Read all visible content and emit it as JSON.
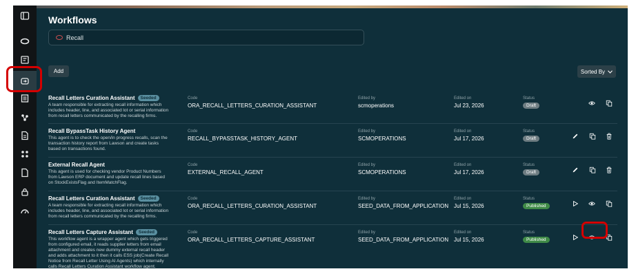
{
  "page": {
    "title": "Workflows"
  },
  "search": {
    "value": "Recall"
  },
  "toolbar": {
    "add_label": "Add",
    "sort_label": "Sorted By"
  },
  "labels": {
    "code": "Code",
    "edited_by": "Edited by",
    "edited_on": "Edited on",
    "status": "Status"
  },
  "sidebar": {
    "items": [
      "panel-toggle-icon",
      "oracle-icon",
      "catalog-icon",
      "workflows-icon",
      "document-list-icon",
      "agent-icon",
      "file-icon",
      "apps-icon",
      "page-icon",
      "lock-icon",
      "gauge-icon"
    ]
  },
  "rows": [
    {
      "name": "Recall Letters Curation Assistant",
      "badge": "Seeded",
      "desc": "A team responsible for extracting recall information which includes header, line, and associated lot or serial information from recall letters communicated by the recalling firms.",
      "code": "ORA_RECALL_LETTERS_CURATION_ASSISTANT",
      "edited_by": "scmoperations",
      "edited_on": "Jul 23, 2026",
      "status": "Draft",
      "actions": [
        "view",
        "duplicate"
      ]
    },
    {
      "name": "Recall BypassTask History Agent",
      "badge": "",
      "desc": "This agent is to check the open/in progress recalls, scan the transaction history report from Lawson and create tasks based on transactions found.",
      "code": "RECALL_BYPASSTASK_HISTORY_AGENT",
      "edited_by": "SCMOPERATIONS",
      "edited_on": "Jul 17, 2026",
      "status": "Draft",
      "actions": [
        "edit",
        "duplicate",
        "delete"
      ]
    },
    {
      "name": "External Recall Agent",
      "badge": "",
      "desc": "This agent is used for checking vendor Product Numbers from Lawson ERP document and update recall lines based on StockExistsFlag and ItemMatchFlag.",
      "code": "EXTERNAL_RECALL_AGENT",
      "edited_by": "SCMOPERATIONS",
      "edited_on": "Jul 17, 2026",
      "status": "Draft",
      "actions": [
        "edit",
        "duplicate",
        "delete"
      ]
    },
    {
      "name": "Recall Letters Curation Assistant",
      "badge": "Seeded",
      "desc": "A team responsible for extracting recall information which includes header, line, and associated lot or serial information from recall letters communicated by the recalling firms.",
      "code": "ORA_RECALL_LETTERS_CURATION_ASSISTANT",
      "edited_by": "SEED_DATA_FROM_APPLICATION",
      "edited_on": "Jul 15, 2026",
      "status": "Published",
      "actions": [
        "run",
        "view",
        "duplicate"
      ]
    },
    {
      "name": "Recall Letters Capture Assistant",
      "badge": "Seeded",
      "desc": "This workflow agent is a wrapper agent which gets triggered from configured email, it reads supplier letters from email attachment and creates new dummy external recall header and adds attachment to it then it calls ESS job(Create Recall Notice from Recall Letter Using AI Agents) which internally calls Recall Letters Curation Assistant workflow agent.",
      "code": "ORA_RECALL_LETTERS_CAPTURE_ASSISTANT",
      "edited_by": "SEED_DATA_FROM_APPLICATION",
      "edited_on": "Jul 15, 2026",
      "status": "Published",
      "actions": [
        "run",
        "view",
        "duplicate"
      ]
    }
  ]
}
